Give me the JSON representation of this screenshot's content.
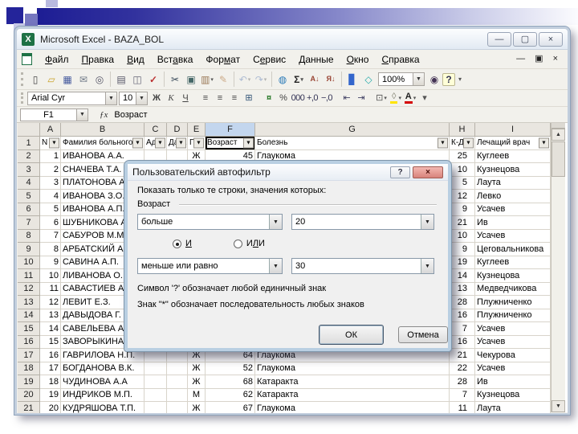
{
  "icons": {
    "dropdown": "▼",
    "filter": "▼",
    "up_arrow": "▲",
    "down_arrow": "▼"
  },
  "window": {
    "title": "Microsoft Excel - BAZA_BOL",
    "icon_glyph": "X",
    "controls": [
      {
        "n": "minimize-button",
        "g": "—"
      },
      {
        "n": "maximize-button",
        "g": "▢"
      },
      {
        "n": "close-button",
        "g": "×"
      }
    ]
  },
  "menubar": {
    "items": [
      {
        "label": "Файл",
        "key": "Ф"
      },
      {
        "label": "Правка",
        "key": "П"
      },
      {
        "label": "Вид",
        "key": "В"
      },
      {
        "label": "Вставка",
        "key": "а"
      },
      {
        "label": "Формат",
        "key": "м"
      },
      {
        "label": "Сервис",
        "key": "е"
      },
      {
        "label": "Данные",
        "key": "Д"
      },
      {
        "label": "Окно",
        "key": "О"
      },
      {
        "label": "Справка",
        "key": "С"
      }
    ],
    "window_controls": [
      {
        "n": "doc-minimize-button",
        "g": "—"
      },
      {
        "n": "doc-restore-button",
        "g": "▣"
      },
      {
        "n": "doc-close-button",
        "g": "×"
      }
    ]
  },
  "standard_toolbar": {
    "items": [
      {
        "n": "new-document-icon",
        "g": "▯"
      },
      {
        "n": "open-folder-icon",
        "g": "▱"
      },
      {
        "n": "save-icon",
        "g": "▦"
      },
      {
        "n": "mail-icon",
        "g": "✉"
      },
      {
        "n": "file-search-icon",
        "g": "◎"
      },
      {
        "sep": true
      },
      {
        "n": "print-icon",
        "g": "▤"
      },
      {
        "n": "print-preview-icon",
        "g": "◫"
      },
      {
        "n": "spelling-icon",
        "g": "✓"
      },
      {
        "sep": true
      },
      {
        "n": "cut-icon",
        "g": "✂"
      },
      {
        "n": "copy-icon",
        "g": "▣"
      },
      {
        "n": "paste-icon",
        "g": "▥",
        "dd": true
      },
      {
        "n": "format-painter-icon",
        "g": "✎"
      },
      {
        "sep": true
      },
      {
        "n": "undo-icon",
        "g": "↶",
        "dd": true,
        "disabled": true
      },
      {
        "n": "redo-icon",
        "g": "↷",
        "dd": true,
        "disabled": true
      },
      {
        "sep": true
      },
      {
        "n": "hyperlink-icon",
        "g": "◍"
      },
      {
        "n": "autosum-icon",
        "g": "Σ",
        "dd": true
      },
      {
        "n": "sort-ascending-icon",
        "g": "А↓"
      },
      {
        "n": "sort-descending-icon",
        "g": "Я↓"
      },
      {
        "sep": true
      },
      {
        "n": "chart-wizard-icon",
        "g": "▊"
      },
      {
        "n": "drawing-icon",
        "g": "◇"
      },
      {
        "combo": true,
        "n": "zoom-combo",
        "value": "100%"
      },
      {
        "n": "find-icon",
        "g": "◉"
      },
      {
        "n": "help-icon",
        "g": "?"
      },
      {
        "n": "toolbar-options-icon",
        "g": "▾"
      }
    ]
  },
  "formatting_toolbar": {
    "font_name": "Arial Cyr",
    "font_size": "10",
    "items": [
      {
        "n": "bold-icon",
        "g": "Ж"
      },
      {
        "n": "italic-icon",
        "g": "К"
      },
      {
        "n": "underline-icon",
        "g": "Ч"
      },
      {
        "sep": true
      },
      {
        "n": "align-left-icon",
        "g": "≡"
      },
      {
        "n": "align-center-icon",
        "g": "≡"
      },
      {
        "n": "align-right-icon",
        "g": "≡"
      },
      {
        "n": "merge-center-icon",
        "g": "⊞"
      },
      {
        "sep": true
      },
      {
        "n": "currency-icon",
        "g": "¤"
      },
      {
        "n": "percent-icon",
        "g": "%"
      },
      {
        "n": "thousands-icon",
        "g": "000"
      },
      {
        "n": "increase-decimal-icon",
        "g": "+,0"
      },
      {
        "n": "decrease-decimal-icon",
        "g": "−,0"
      },
      {
        "sep": true
      },
      {
        "n": "decrease-indent-icon",
        "g": "⇤"
      },
      {
        "n": "increase-indent-icon",
        "g": "⇥"
      },
      {
        "sep": true
      },
      {
        "n": "borders-icon",
        "g": "⊡",
        "dd": true
      },
      {
        "n": "fill-color-icon",
        "g": "◊",
        "dd": true
      },
      {
        "n": "font-color-icon",
        "g": "А",
        "dd": true
      },
      {
        "n": "toolbar-options-icon",
        "g": "▾"
      }
    ]
  },
  "formula_bar": {
    "cell_ref": "F1",
    "fx_label": "ƒx",
    "value": "Возраст"
  },
  "grid": {
    "columns": [
      {
        "letter": "A",
        "header": "N"
      },
      {
        "letter": "B",
        "header": "Фамилия больного"
      },
      {
        "letter": "C",
        "header": "Адр"
      },
      {
        "letter": "D",
        "header": "Дата"
      },
      {
        "letter": "E",
        "header": "По"
      },
      {
        "letter": "F",
        "header": "Возраст",
        "selected": true
      },
      {
        "letter": "G",
        "header": "Болезнь"
      },
      {
        "letter": "H",
        "header": "К-Д"
      },
      {
        "letter": "I",
        "header": "Лечащий врач"
      }
    ],
    "rows": [
      {
        "r": 2,
        "cells": [
          "1",
          "ИВАНОВА А.А.",
          "",
          "",
          "Ж",
          "45",
          "Глаукома",
          "25",
          "Куглеев"
        ]
      },
      {
        "r": 3,
        "cells": [
          "2",
          "СНАЧЕВА Т.А.",
          "",
          "",
          "",
          "",
          "",
          "10",
          "Кузнецова"
        ]
      },
      {
        "r": 4,
        "cells": [
          "3",
          "ПЛАТОНОВА А.",
          "",
          "",
          "",
          "",
          "",
          "5",
          "Лаута"
        ]
      },
      {
        "r": 5,
        "cells": [
          "4",
          "ИВАНОВА З.О.",
          "",
          "",
          "",
          "",
          "",
          "12",
          "Левко"
        ]
      },
      {
        "r": 6,
        "cells": [
          "5",
          "ИВАНОВА А.П.",
          "",
          "",
          "",
          "",
          "",
          "9",
          "Усачев"
        ]
      },
      {
        "r": 7,
        "cells": [
          "6",
          "ШУБНИКОВА А.",
          "",
          "",
          "",
          "",
          "",
          "21",
          "Ив"
        ]
      },
      {
        "r": 8,
        "cells": [
          "7",
          "САБУРОВ М.М.",
          "",
          "",
          "",
          "",
          "",
          "10",
          "Усачев"
        ]
      },
      {
        "r": 9,
        "cells": [
          "8",
          "АРБАТСКИЙ А.",
          "",
          "",
          "",
          "",
          "",
          "9",
          "Цеговальникова"
        ]
      },
      {
        "r": 10,
        "cells": [
          "9",
          "САВИНА А.П.",
          "",
          "",
          "",
          "",
          "",
          "19",
          "Куглеев"
        ]
      },
      {
        "r": 11,
        "cells": [
          "10",
          "ЛИВАНОВА О.",
          "",
          "",
          "",
          "",
          "",
          "14",
          "Кузнецова"
        ]
      },
      {
        "r": 12,
        "cells": [
          "11",
          "САВАСТИЕВ А.",
          "",
          "",
          "",
          "",
          "",
          "13",
          "Медведчикова"
        ]
      },
      {
        "r": 13,
        "cells": [
          "12",
          "ЛЕВИТ Е.З.",
          "",
          "",
          "",
          "",
          "",
          "28",
          "Плужниченко"
        ]
      },
      {
        "r": 14,
        "cells": [
          "13",
          "ДАВЫДОВА Г.",
          "",
          "",
          "",
          "",
          "",
          "16",
          "Плужниченко"
        ]
      },
      {
        "r": 15,
        "cells": [
          "14",
          "САВЕЛЬЕВА А.",
          "",
          "",
          "",
          "",
          "",
          "7",
          "Усачев"
        ]
      },
      {
        "r": 16,
        "cells": [
          "15",
          "ЗАВОРЫКИНА А.",
          "",
          "",
          "",
          "",
          "",
          "16",
          "Усачев"
        ]
      },
      {
        "r": 17,
        "cells": [
          "16",
          "ГАВРИЛОВА Н.П.",
          "",
          "",
          "Ж",
          "64",
          "Глаукома",
          "21",
          "Чекурова"
        ]
      },
      {
        "r": 18,
        "cells": [
          "17",
          "БОГДАНОВА В.К.",
          "",
          "",
          "Ж",
          "52",
          "Глаукома",
          "22",
          "Усачев"
        ]
      },
      {
        "r": 19,
        "cells": [
          "18",
          "ЧУДИНОВА А.А",
          "",
          "",
          "Ж",
          "68",
          "Катаракта",
          "28",
          "Ив"
        ]
      },
      {
        "r": 20,
        "cells": [
          "19",
          "ИНДРИКОВ М.П.",
          "",
          "",
          "М",
          "62",
          "Катаракта",
          "7",
          "Кузнецова"
        ]
      },
      {
        "r": 21,
        "cells": [
          "20",
          "КУДРЯШОВА Т.П.",
          "",
          "",
          "Ж",
          "67",
          "Глаукома",
          "11",
          "Лаута"
        ]
      }
    ]
  },
  "dialog": {
    "title": "Пользовательский автофильтр",
    "help_glyph": "?",
    "close_glyph": "×",
    "instruction": "Показать только те строки, значения которых:",
    "field_label": "Возраст",
    "condition1": {
      "operator": "больше",
      "value": "20"
    },
    "conjunction": {
      "and_label": "И",
      "and_key": "И",
      "or_label": "ИЛИ",
      "or_key": "Л",
      "selected": "and"
    },
    "condition2": {
      "operator": "меньше или равно",
      "value": "30"
    },
    "hint1": "Символ '?' обозначает любой единичный знак",
    "hint2": "Знак \"*\" обозначает последовательность любых знаков",
    "ok_label": "ОК",
    "cancel_label": "Отмена"
  }
}
